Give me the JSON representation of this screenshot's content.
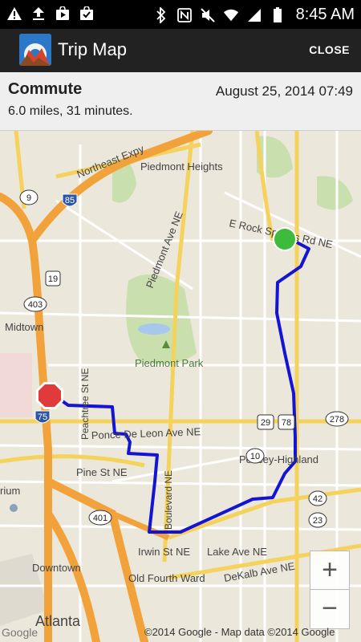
{
  "status_bar": {
    "time": "8:45 AM",
    "left_icons": [
      "warning-icon",
      "upload-icon",
      "play-store-icon",
      "shopping-bag-icon"
    ],
    "right_icons": [
      "bluetooth-icon",
      "nfc-icon",
      "mute-icon",
      "wifi-icon",
      "signal-icon",
      "battery-icon"
    ]
  },
  "action_bar": {
    "title": "Trip Map",
    "close_label": "CLOSE"
  },
  "trip": {
    "name": "Commute",
    "date": "August 25, 2014  07:49",
    "stats": "6.0 miles, 31 minutes."
  },
  "map": {
    "labels": {
      "northeast_expy": "Northeast Expy",
      "piedmont_heights": "Piedmont Heights",
      "piedmont_ave": "Piedmont Ave NE",
      "e_rock_springs": "E Rock Springs Rd NE",
      "midtown": "Midtown",
      "piedmont_park": "Piedmont Park",
      "peachtree": "Peachtree St NE",
      "ponce": "Ponce De Leon Ave NE",
      "poncey": "Poncey-Highland",
      "pine": "Pine St NE",
      "boulevard": "Boulevard NE",
      "irwin": "Irwin St NE",
      "lake_ave": "Lake Ave NE",
      "downtown": "Downtown",
      "old_fourth": "Old Fourth Ward",
      "dekalb": "DeKalb Ave NE",
      "atlanta": "Atlanta",
      "rium": "rium"
    },
    "shields": {
      "i85": "85",
      "i75": "75",
      "us19": "19",
      "us29": "29",
      "us78": "78",
      "r9": "9",
      "r10": "10",
      "r42": "42",
      "r23": "23",
      "r278": "278",
      "r403": "403",
      "r401": "401"
    },
    "copyright": "©2014 Google - Map data ©2014 Google",
    "start_marker": "green-circle",
    "end_marker": "stop-sign",
    "route_color": "#1414d4",
    "start_color": "#3dbb3d",
    "stop_color": "#e03a3a"
  },
  "zoom": {
    "in_label": "+",
    "out_label": "−"
  }
}
